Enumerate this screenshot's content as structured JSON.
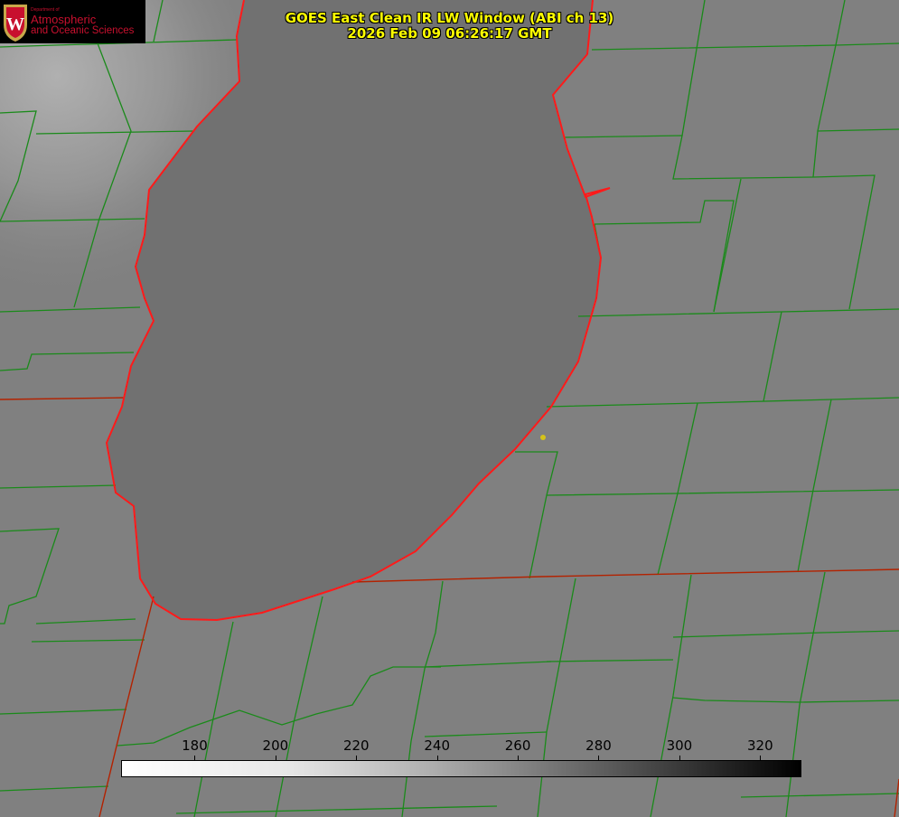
{
  "title": {
    "line1": "GOES East Clean IR LW Window (ABI ch 13)",
    "line2": "2026 Feb 09 06:26:17 GMT"
  },
  "logo": {
    "department": "Department of",
    "line1": "Atmospheric",
    "line2": "and Oceanic Sciences",
    "crest_letter": "W"
  },
  "colorbar": {
    "ticks": [
      "180",
      "200",
      "220",
      "240",
      "260",
      "280",
      "300",
      "320"
    ],
    "range": [
      162,
      330
    ],
    "colormap": "white-to-black (cold bright)"
  },
  "colors": {
    "land": "#808080",
    "lake": "#707070",
    "county_lines": "#1a8a1a",
    "state_lines": "#cc2200",
    "shoreline": "#ff1a1a",
    "title": "#ffff00",
    "marker": "#d4c21a"
  }
}
